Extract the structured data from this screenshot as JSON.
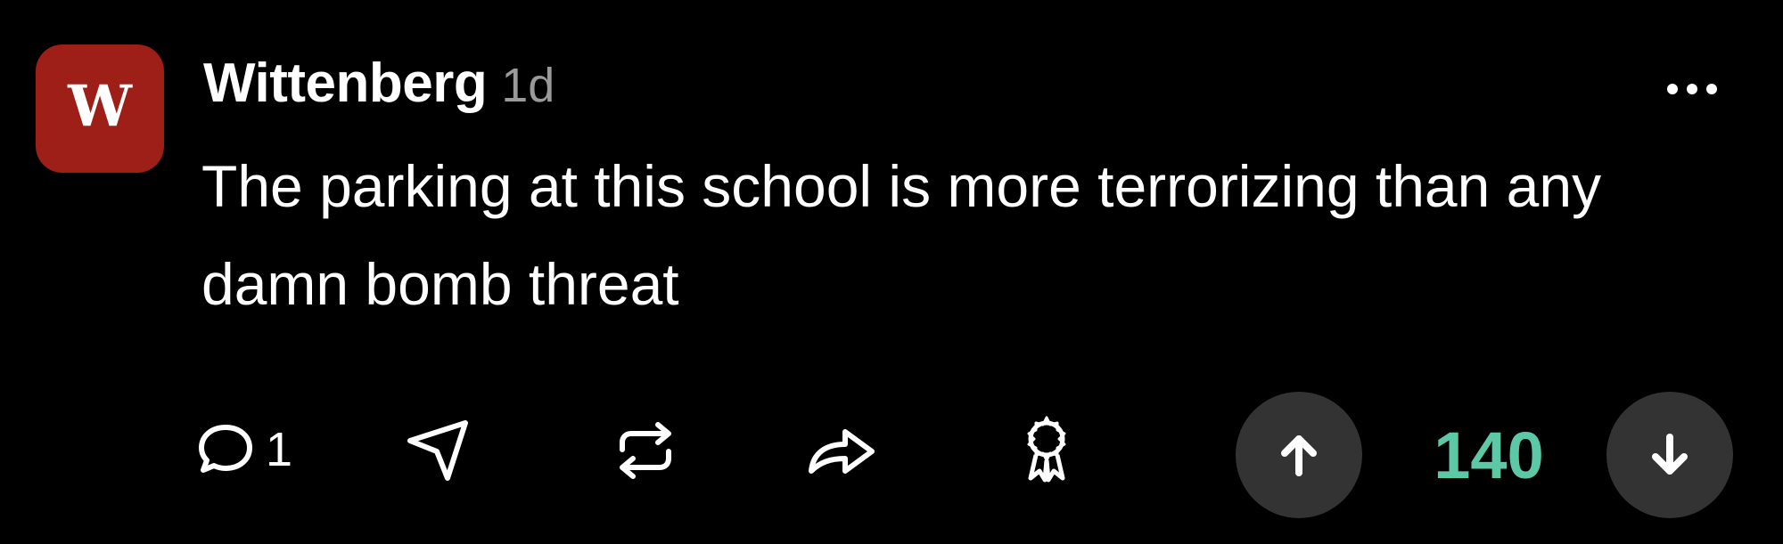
{
  "post": {
    "avatar_letter": "W",
    "author": "Wittenberg",
    "time": "1d",
    "text": "The parking at this school is more terrorizing than any damn bomb threat"
  },
  "actions": {
    "comment_count": "1",
    "score": "140"
  },
  "icons": {
    "more": "more-horizontal-icon",
    "comment": "comment-bubble-icon",
    "send": "send-arrow-icon",
    "repost": "repost-icon",
    "share": "share-arrow-icon",
    "award": "award-ribbon-icon",
    "upvote": "arrow-up-icon",
    "downvote": "arrow-down-icon"
  },
  "colors": {
    "avatar_bg": "#9e1f17",
    "score": "#5cc8a6",
    "time": "#9a9a9a",
    "vote_button_bg": "#333333"
  }
}
